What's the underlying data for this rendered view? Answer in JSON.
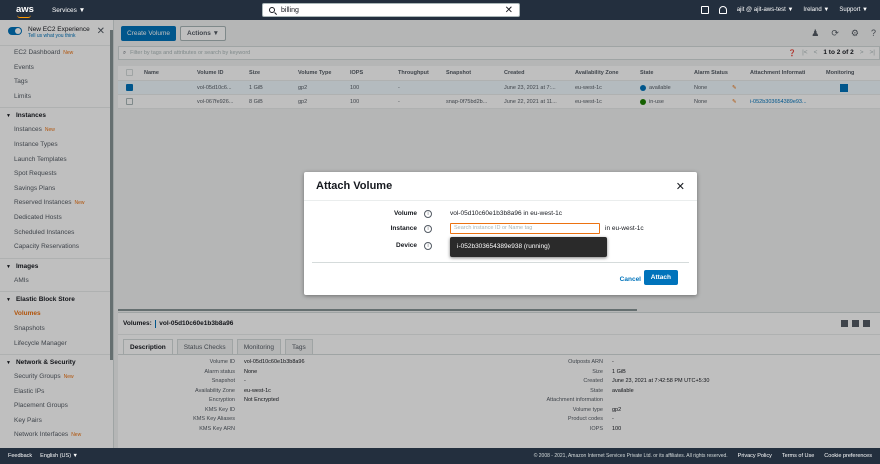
{
  "topbar": {
    "logo": "aws",
    "services": "Services ▼",
    "search_value": "billing",
    "user": "ajit @ ajit-aws-test ▼",
    "region": "Ireland ▼",
    "support": "Support ▼"
  },
  "sidebar": {
    "new_exp_title": "New EC2 Experience",
    "new_exp_sub": "Tell us what you think",
    "items": [
      {
        "label": "EC2 Dashboard",
        "new": "New"
      },
      {
        "label": "Events"
      },
      {
        "label": "Tags"
      },
      {
        "label": "Limits"
      }
    ],
    "sections": [
      {
        "title": "Instances",
        "items": [
          {
            "label": "Instances",
            "new": "New"
          },
          {
            "label": "Instance Types"
          },
          {
            "label": "Launch Templates"
          },
          {
            "label": "Spot Requests"
          },
          {
            "label": "Savings Plans"
          },
          {
            "label": "Reserved Instances",
            "new": "New"
          },
          {
            "label": "Dedicated Hosts"
          },
          {
            "label": "Scheduled Instances"
          },
          {
            "label": "Capacity Reservations"
          }
        ]
      },
      {
        "title": "Images",
        "items": [
          {
            "label": "AMIs"
          }
        ]
      },
      {
        "title": "Elastic Block Store",
        "items": [
          {
            "label": "Volumes"
          },
          {
            "label": "Snapshots"
          },
          {
            "label": "Lifecycle Manager"
          }
        ]
      },
      {
        "title": "Network & Security",
        "items": [
          {
            "label": "Security Groups",
            "new": "New"
          },
          {
            "label": "Elastic IPs"
          },
          {
            "label": "Placement Groups"
          },
          {
            "label": "Key Pairs"
          },
          {
            "label": "Network Interfaces",
            "new": "New"
          }
        ]
      }
    ]
  },
  "toolbar": {
    "create": "Create Volume",
    "actions": "Actions ▼"
  },
  "filter": {
    "placeholder": "Filter by tags and attributes or search by keyword",
    "pagination": "1 to 2 of 2"
  },
  "table": {
    "headers": [
      "Name",
      "Volume ID",
      "Size",
      "Volume Type",
      "IOPS",
      "Throughput",
      "Snapshot",
      "Created",
      "Availability Zone",
      "State",
      "Alarm Status",
      "Attachment Informati",
      "Monitoring"
    ],
    "rows": [
      {
        "name": "",
        "id": "vol-05d10c6...",
        "size": "1 GiB",
        "type": "gp2",
        "iops": "100",
        "throughput": "-",
        "snapshot": "",
        "created": "June 23, 2021 at 7:...",
        "az": "eu-west-1c",
        "state": "available",
        "state_color": "#0073bb",
        "alarm": "None",
        "attach": ""
      },
      {
        "name": "",
        "id": "vol-067fe926...",
        "size": "8 GiB",
        "type": "gp2",
        "iops": "100",
        "throughput": "-",
        "snapshot": "snap-0f75bd2b...",
        "created": "June 22, 2021 at 11...",
        "az": "eu-west-1c",
        "state": "in-use",
        "state_color": "#1d8102",
        "alarm": "None",
        "attach": "i-052b303654389e93..."
      }
    ]
  },
  "detail": {
    "title_prefix": "Volumes:",
    "title_id": "vol-05d10c60e1b3b8a96",
    "tabs": [
      "Description",
      "Status Checks",
      "Monitoring",
      "Tags"
    ],
    "left": [
      {
        "k": "Volume ID",
        "v": "vol-05d10c60e1b3b8a96"
      },
      {
        "k": "Alarm status",
        "v": "None"
      },
      {
        "k": "Snapshot",
        "v": "-"
      },
      {
        "k": "Availability Zone",
        "v": "eu-west-1c"
      },
      {
        "k": "Encryption",
        "v": "Not Encrypted"
      },
      {
        "k": "KMS Key ID",
        "v": ""
      },
      {
        "k": "KMS Key Aliases",
        "v": ""
      },
      {
        "k": "KMS Key ARN",
        "v": ""
      }
    ],
    "right": [
      {
        "k": "Outposts ARN",
        "v": "-"
      },
      {
        "k": "Size",
        "v": "1 GiB"
      },
      {
        "k": "Created",
        "v": "June 23, 2021 at 7:42:58 PM UTC+5:30"
      },
      {
        "k": "State",
        "v": "available"
      },
      {
        "k": "Attachment information",
        "v": ""
      },
      {
        "k": "Volume type",
        "v": "gp2"
      },
      {
        "k": "Product codes",
        "v": "-"
      },
      {
        "k": "IOPS",
        "v": "100"
      }
    ]
  },
  "modal": {
    "title": "Attach Volume",
    "volume_label": "Volume",
    "volume_value": "vol-05d10c60e1b3b8a96 in eu-west-1c",
    "instance_label": "Instance",
    "instance_placeholder": "Search instance ID or Name tag",
    "instance_suffix": "in eu-west-1c",
    "device_label": "Device",
    "suggestion": "i-052b303654389e938 (running)",
    "cancel": "Cancel",
    "attach": "Attach"
  },
  "footer": {
    "feedback": "Feedback",
    "language": "English (US) ▼",
    "copyright": "© 2008 - 2021, Amazon Internet Services Private Ltd. or its affiliates. All rights reserved.",
    "privacy": "Privacy Policy",
    "terms": "Terms of Use",
    "cookies": "Cookie preferences"
  }
}
